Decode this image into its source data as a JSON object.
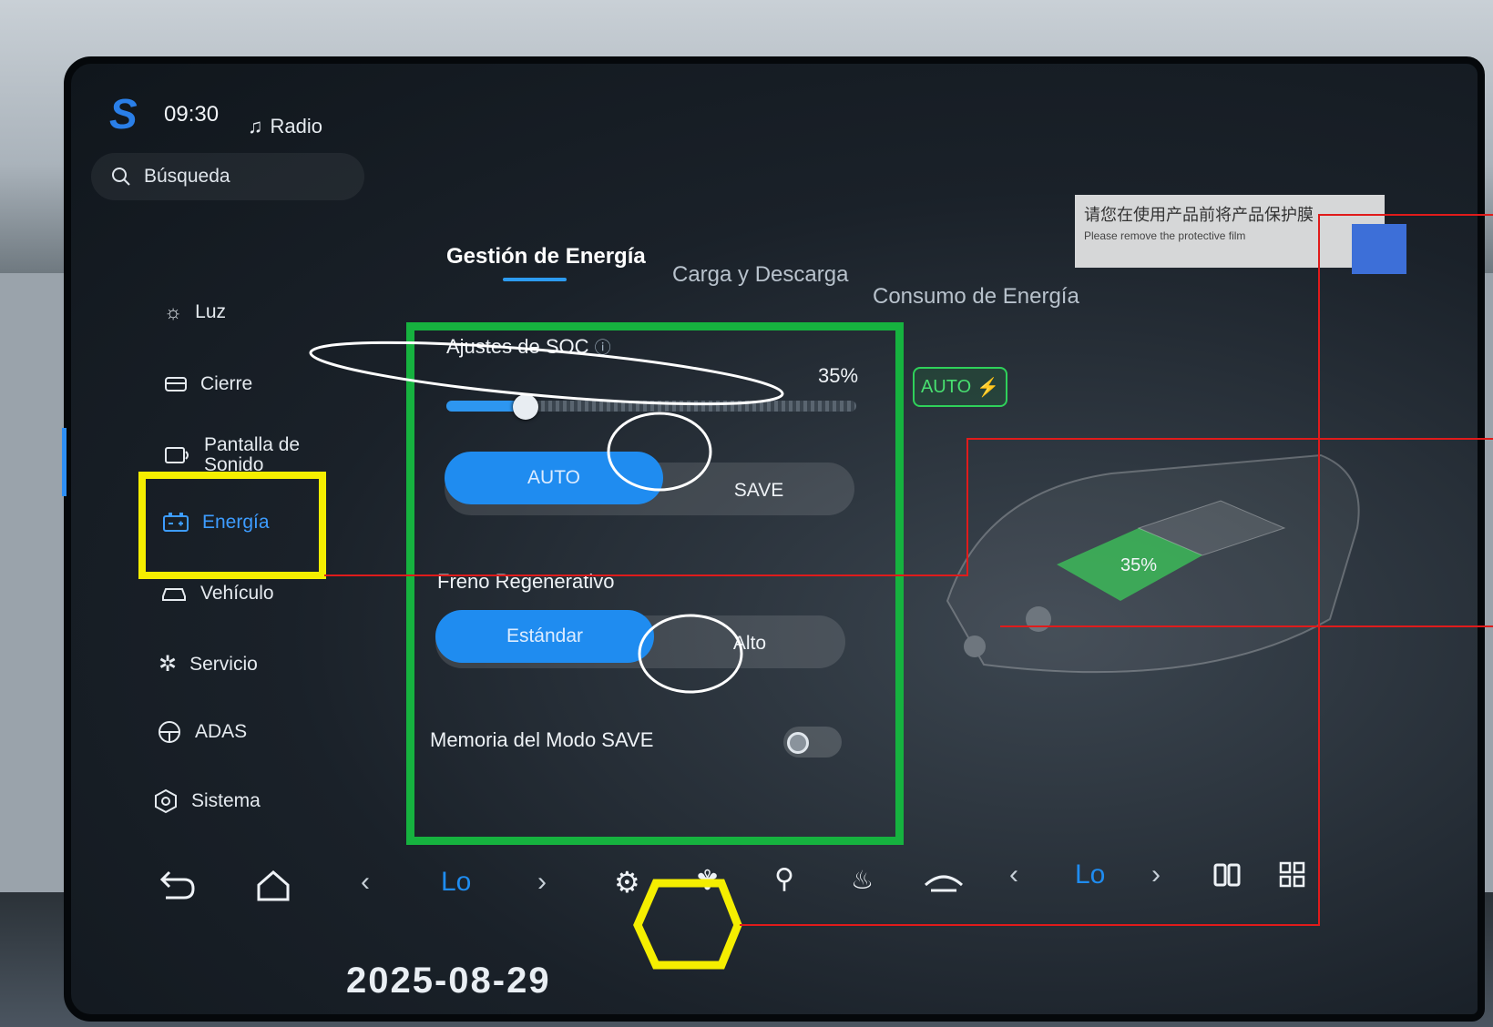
{
  "status": {
    "time": "09:30",
    "media_label": "Radio"
  },
  "search": {
    "label": "Búsqueda"
  },
  "sidebar": {
    "items": [
      {
        "label": "Luz"
      },
      {
        "label": "Cierre"
      },
      {
        "label": "Pantalla de Sonido"
      },
      {
        "label": "Energía",
        "active": true
      },
      {
        "label": "Vehículo"
      },
      {
        "label": "Servicio"
      },
      {
        "label": "ADAS"
      },
      {
        "label": "Sistema"
      }
    ]
  },
  "tabs": [
    {
      "label": "Gestión de Energía",
      "active": true
    },
    {
      "label": "Carga y Descarga"
    },
    {
      "label": "Consumo de Energía"
    }
  ],
  "soc": {
    "title": "Ajustes de SOC",
    "value_label": "35%",
    "value": 0.35,
    "modes": {
      "selected": "AUTO",
      "other": "SAVE"
    }
  },
  "regen": {
    "title": "Freno Regenerativo",
    "options": {
      "selected": "Estándar",
      "other": "Alto"
    }
  },
  "save_memory": {
    "label": "Memoria del Modo SAVE",
    "on": false
  },
  "auto_badge": "AUTO",
  "vehicle_soc_label": "35%",
  "notice": {
    "text_cn": "请您在使用产品前将产品保护膜",
    "text_en": "Please remove the protective film"
  },
  "dock": {
    "left_temp": "Lo",
    "right_temp": "Lo",
    "icons": [
      "back-icon",
      "home-icon",
      "settings-icon",
      "fan-icon",
      "seat-airflow-icon",
      "front-defrost-icon",
      "recirculation-icon",
      "split-screen-icon",
      "app-grid-icon"
    ]
  },
  "date_fragment": "2025-08-29",
  "colors": {
    "accent": "#1f8cf0",
    "highlight_yellow": "#f5ee00",
    "highlight_green": "#16b23f",
    "callout_red": "#e01b1b"
  }
}
